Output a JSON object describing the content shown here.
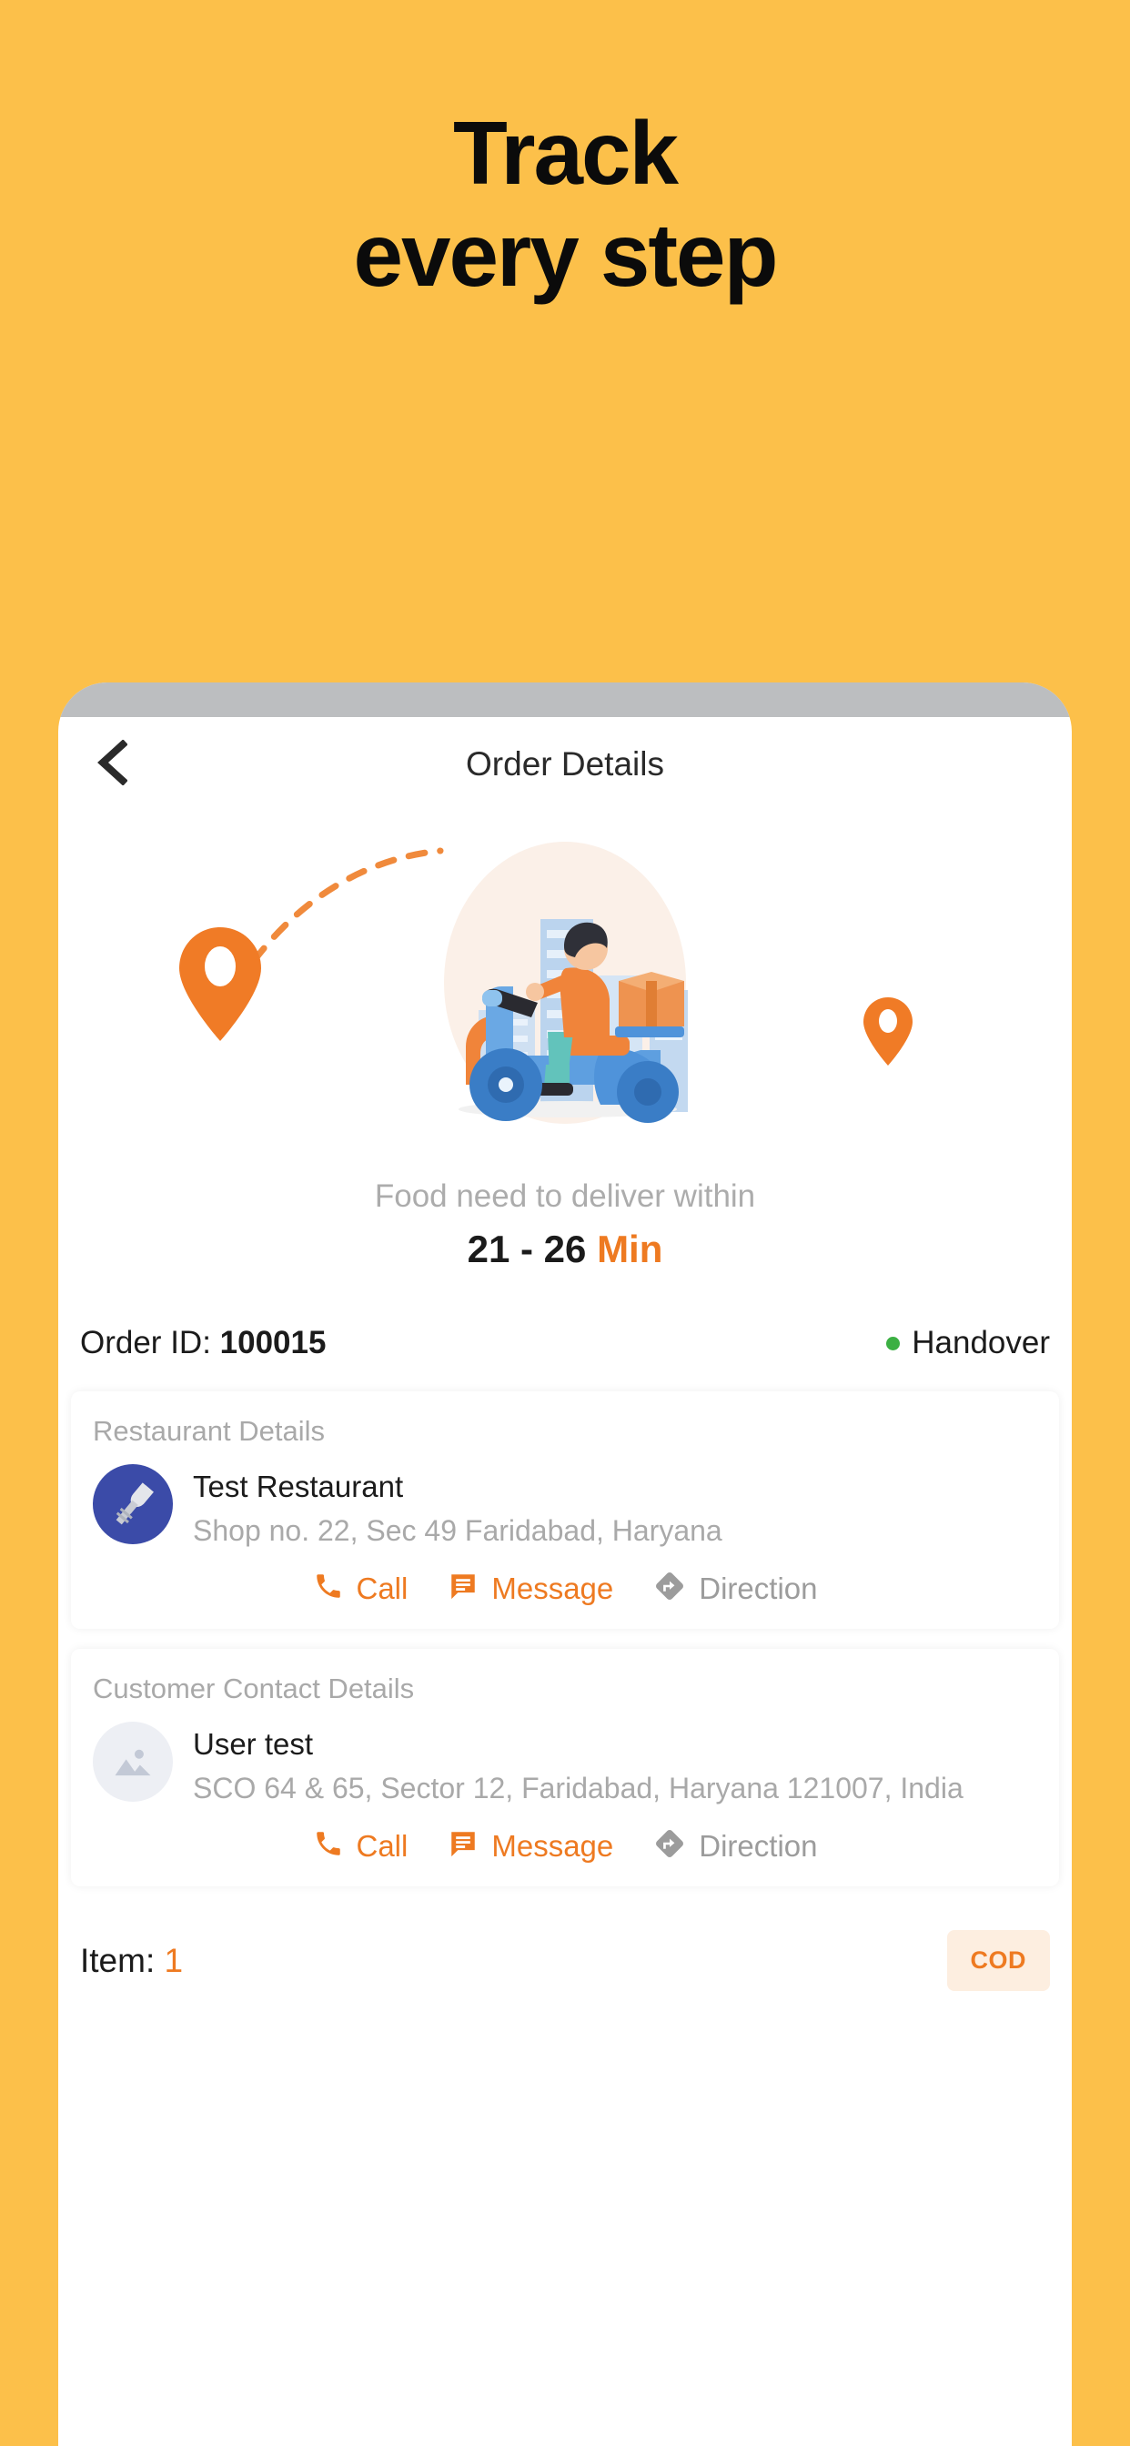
{
  "hero": {
    "line1": "Track",
    "line2": "every step"
  },
  "colors": {
    "background": "#FCC04A",
    "accent_orange": "#EE7A21",
    "status_green": "#3CB043",
    "muted_gray": "#A9A9A9",
    "status_bar_gray": "#BCBEC0",
    "restaurant_avatar_blue": "#3B4BA8",
    "cod_badge_bg": "#FDEEE0"
  },
  "appbar": {
    "back_icon": "chevron-left-icon",
    "title": "Order Details"
  },
  "illustration": {
    "name": "delivery-scooter-illustration",
    "pin_start": "location-pin-icon",
    "pin_end": "location-pin-icon",
    "route": "dashed-route-arc"
  },
  "delivery": {
    "note": "Food need to deliver within",
    "time_value": "21 - 26",
    "time_unit": "Min"
  },
  "order": {
    "id_label": "Order ID:",
    "id_value": "100015",
    "status": "Handover"
  },
  "restaurant_card": {
    "section_label": "Restaurant Details",
    "avatar_icon": "restaurant-cutlery-icon",
    "name": "Test Restaurant",
    "address": "Shop no. 22, Sec 49 Faridabad, Haryana",
    "actions": [
      {
        "label": "Call",
        "icon": "phone-icon"
      },
      {
        "label": "Message",
        "icon": "chat-bubble-icon"
      },
      {
        "label": "Direction",
        "icon": "direction-arrow-icon"
      }
    ]
  },
  "customer_card": {
    "section_label": "Customer Contact Details",
    "avatar_icon": "image-placeholder-icon",
    "name": "User test",
    "address": "SCO 64 & 65, Sector 12, Faridabad, Haryana 121007, India",
    "actions": [
      {
        "label": "Call",
        "icon": "phone-icon"
      },
      {
        "label": "Message",
        "icon": "chat-bubble-icon"
      },
      {
        "label": "Direction",
        "icon": "direction-arrow-icon"
      }
    ]
  },
  "footer": {
    "item_label": "Item:",
    "item_count": "1",
    "payment_badge": "COD"
  }
}
